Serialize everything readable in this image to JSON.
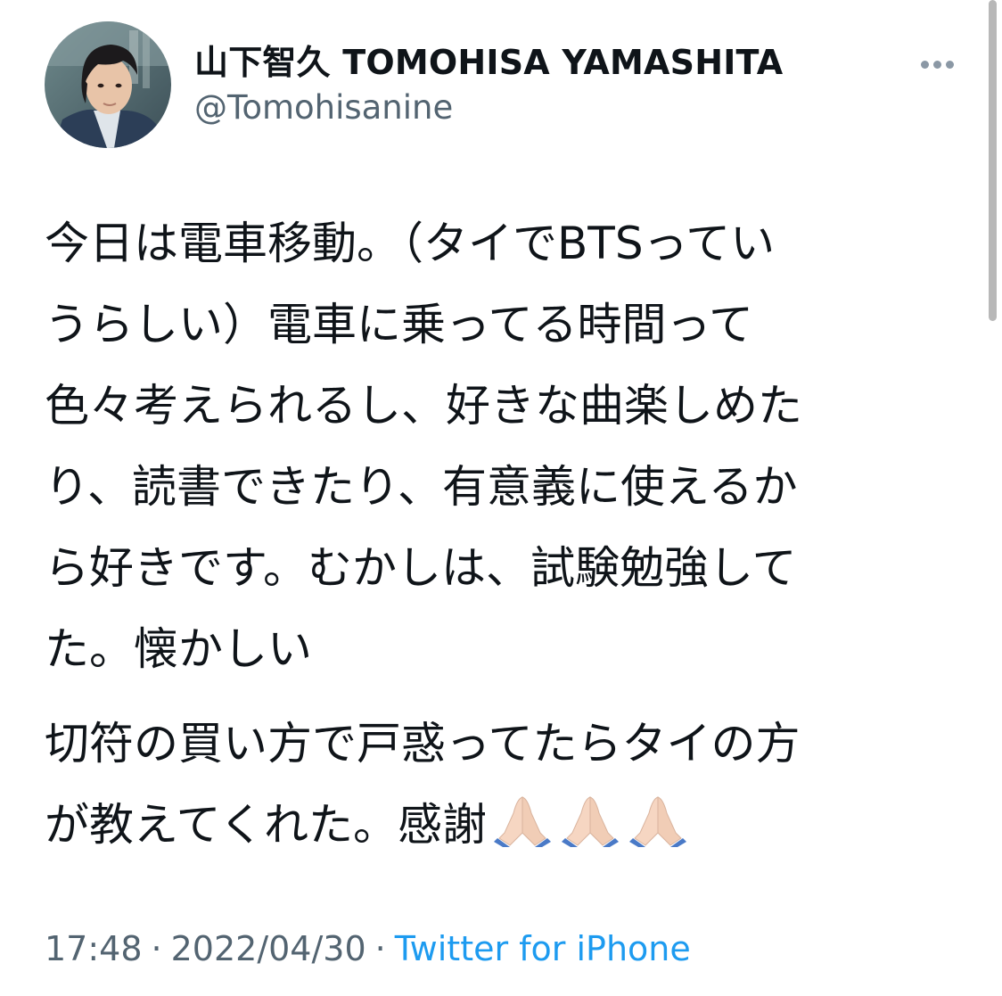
{
  "tweet": {
    "author": {
      "display_name": "山下智久 TOMOHISA YAMASHITA",
      "handle": "@Tomohisanine"
    },
    "text": {
      "paragraph1_lines": [
        "今日は電車移動。（タイでBTSってい",
        "うらしい）電車に乗ってる時間って",
        "色々考えられるし、好きな曲楽しめた",
        "り、読書できたり、有意義に使えるか",
        "ら好きです。むかしは、試験勉強して",
        "た。懐かしい"
      ],
      "paragraph2_lines": [
        "切符の買い方で戸惑ってたらタイの方",
        "が教えてくれた。感謝"
      ],
      "emoji": [
        "folded-hands",
        "folded-hands",
        "folded-hands"
      ]
    },
    "meta": {
      "time": "17:48",
      "separator": "·",
      "date": "2022/04/30",
      "source": "Twitter for iPhone"
    }
  },
  "colors": {
    "text": "#0f1419",
    "secondary": "#536471",
    "link": "#1d9bf0",
    "more_dots": "#8b98a5"
  }
}
